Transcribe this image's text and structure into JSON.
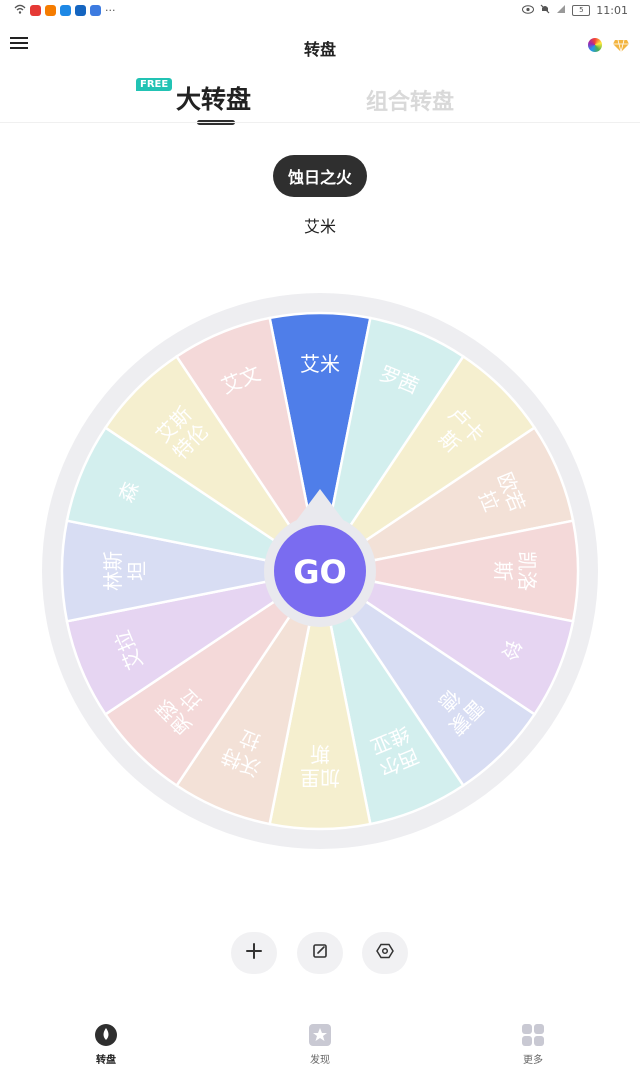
{
  "status_bar": {
    "battery": "5",
    "time": "11:01"
  },
  "header": {
    "title": "转盘"
  },
  "tabs": [
    {
      "label": "大转盘",
      "badge": "FREE",
      "active": true
    },
    {
      "label": "组合转盘",
      "active": false
    }
  ],
  "result": {
    "pill": "蚀日之火",
    "text": "艾米"
  },
  "wheel": {
    "center_label": "GO",
    "colors": {
      "rim": "#eeeef1",
      "hub_ring": "#e9e9ee",
      "hub": "#7a6cf0",
      "highlight": "#4f7ee9"
    },
    "segments": [
      {
        "label": "艾米",
        "color": "#4f7ee9"
      },
      {
        "label": "罗茜",
        "color": "#d3efee"
      },
      {
        "label": "卢卡斯",
        "color": "#f5efcf"
      },
      {
        "label": "欧若拉",
        "color": "#f3e1d7"
      },
      {
        "label": "凯洛斯",
        "color": "#f4d9d9"
      },
      {
        "label": "铃",
        "color": "#e6d5f2"
      },
      {
        "label": "雷蒙德",
        "color": "#d8ddf3"
      },
      {
        "label": "西尔维亚",
        "color": "#d3efee"
      },
      {
        "label": "加里斯",
        "color": "#f5efcf"
      },
      {
        "label": "沃特拉",
        "color": "#f3e1d7"
      },
      {
        "label": "奥瑟拉",
        "color": "#f4d9d9"
      },
      {
        "label": "艾拉",
        "color": "#e6d5f2"
      },
      {
        "label": "林斯坦",
        "color": "#d8ddf3"
      },
      {
        "label": "森",
        "color": "#d3efee"
      },
      {
        "label": "艾斯特伦",
        "color": "#f5efcf"
      },
      {
        "label": "艾文",
        "color": "#f4d9d9"
      }
    ]
  },
  "actions": [
    {
      "name": "add-button",
      "icon": "plus-icon"
    },
    {
      "name": "edit-button",
      "icon": "edit-icon"
    },
    {
      "name": "settings-button",
      "icon": "hexagon-settings-icon"
    }
  ],
  "bottom_nav": [
    {
      "label": "转盘",
      "icon": "wheel-icon",
      "active": true
    },
    {
      "label": "发现",
      "icon": "discover-icon",
      "active": false
    },
    {
      "label": "更多",
      "icon": "more-grid-icon",
      "active": false
    }
  ]
}
